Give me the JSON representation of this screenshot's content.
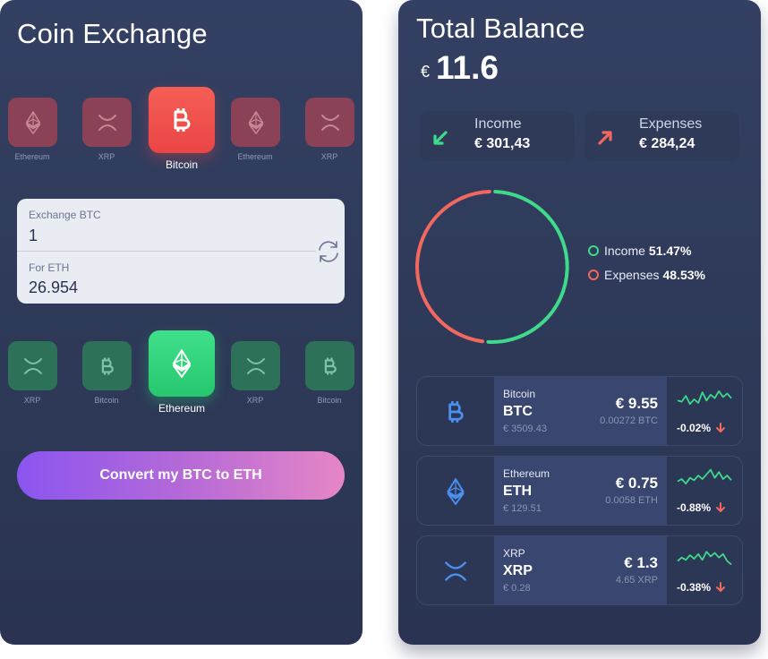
{
  "coin_exchange": {
    "title": "Coin Exchange",
    "from_coins": [
      {
        "label": "Ethereum",
        "icon": "ethereum-icon"
      },
      {
        "label": "XRP",
        "icon": "xrp-icon"
      },
      {
        "label": "Bitcoin",
        "icon": "bitcoin-icon",
        "selected": true
      },
      {
        "label": "Ethereum",
        "icon": "ethereum-icon"
      },
      {
        "label": "XRP",
        "icon": "xrp-icon"
      }
    ],
    "to_coins": [
      {
        "label": "XRP",
        "icon": "xrp-icon"
      },
      {
        "label": "Bitcoin",
        "icon": "bitcoin-icon"
      },
      {
        "label": "Ethereum",
        "icon": "ethereum-icon",
        "selected": true
      },
      {
        "label": "XRP",
        "icon": "xrp-icon"
      },
      {
        "label": "Bitcoin",
        "icon": "bitcoin-icon"
      }
    ],
    "exchange_label": "Exchange BTC",
    "exchange_value": "1",
    "for_label": "For ETH",
    "for_value": "26.954",
    "convert_label": "Convert my BTC to ETH",
    "colors": {
      "from_accent": "#f04e4e",
      "to_accent": "#2ed477",
      "button_start": "#8a55f0",
      "button_end": "#e686c6"
    }
  },
  "total_balance": {
    "title": "Total Balance",
    "currency": "€",
    "value": "11.6",
    "income": {
      "label": "Income",
      "value": "€ 301,43",
      "icon": "arrow-down-left-icon",
      "color": "#3ed98a"
    },
    "expenses": {
      "label": "Expenses",
      "value": "€ 284,24",
      "icon": "arrow-up-right-icon",
      "color": "#f2675f"
    },
    "legend": {
      "income_label": "Income",
      "income_pct": "51.47%",
      "expenses_label": "Expenses",
      "expenses_pct": "48.53%"
    },
    "chart_data": {
      "type": "pie",
      "categories": [
        "Income",
        "Expenses"
      ],
      "values": [
        51.47,
        48.53
      ],
      "colors": [
        "#3ed98a",
        "#f2675f"
      ]
    },
    "coins": [
      {
        "name": "Bitcoin",
        "symbol": "BTC",
        "price": "€ 3509.43",
        "fiat": "€ 9.55",
        "amount": "0.00272 BTC",
        "change": "-0.02%",
        "icon": "bitcoin-icon",
        "trend": [
          0.55,
          0.6,
          0.35,
          0.7,
          0.5,
          0.65,
          0.2,
          0.55,
          0.3,
          0.45,
          0.15,
          0.4,
          0.25,
          0.45
        ]
      },
      {
        "name": "Ethereum",
        "symbol": "ETH",
        "price": "€ 129.51",
        "fiat": "€ 0.75",
        "amount": "0.0058 ETH",
        "change": "-0.88%",
        "icon": "ethereum-icon",
        "trend": [
          0.6,
          0.5,
          0.7,
          0.45,
          0.55,
          0.35,
          0.5,
          0.3,
          0.1,
          0.45,
          0.2,
          0.5,
          0.35,
          0.55
        ]
      },
      {
        "name": "XRP",
        "symbol": "XRP",
        "price": "€ 0.28",
        "fiat": "€ 1.3",
        "amount": "4.65 XRP",
        "change": "-0.38%",
        "icon": "xrp-icon",
        "trend": [
          0.6,
          0.45,
          0.55,
          0.35,
          0.5,
          0.3,
          0.55,
          0.2,
          0.4,
          0.25,
          0.45,
          0.3,
          0.6,
          0.75
        ]
      }
    ]
  }
}
